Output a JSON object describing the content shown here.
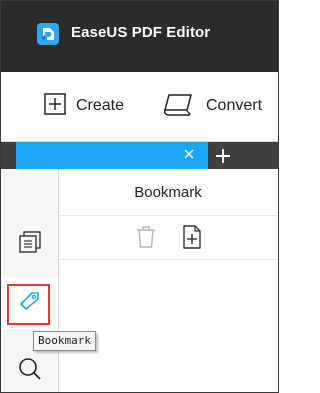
{
  "app": {
    "title": "EaseUS PDF Editor"
  },
  "toolbar": {
    "create_label": "Create",
    "convert_label": "Convert"
  },
  "tabs": {
    "active_tab_label": ""
  },
  "panel": {
    "title": "Bookmark"
  },
  "tooltip": {
    "text": "Bookmark"
  },
  "icons": {
    "app_logo": "easeus-pdf-logo-icon",
    "create": "plus-square-icon",
    "convert": "convert-document-icon",
    "tab_close": "close-icon",
    "tab_add": "plus-icon",
    "thumbnails": "page-thumbnails-icon",
    "bookmark": "bookmark-tag-icon",
    "search": "search-icon",
    "delete": "trash-icon",
    "add_bookmark": "add-page-icon"
  },
  "colors": {
    "titlebar_bg": "#2b2b2b",
    "tab_active": "#1ea7f5",
    "accent_blue": "#1ea7f5",
    "highlight_red": "#e53935"
  }
}
